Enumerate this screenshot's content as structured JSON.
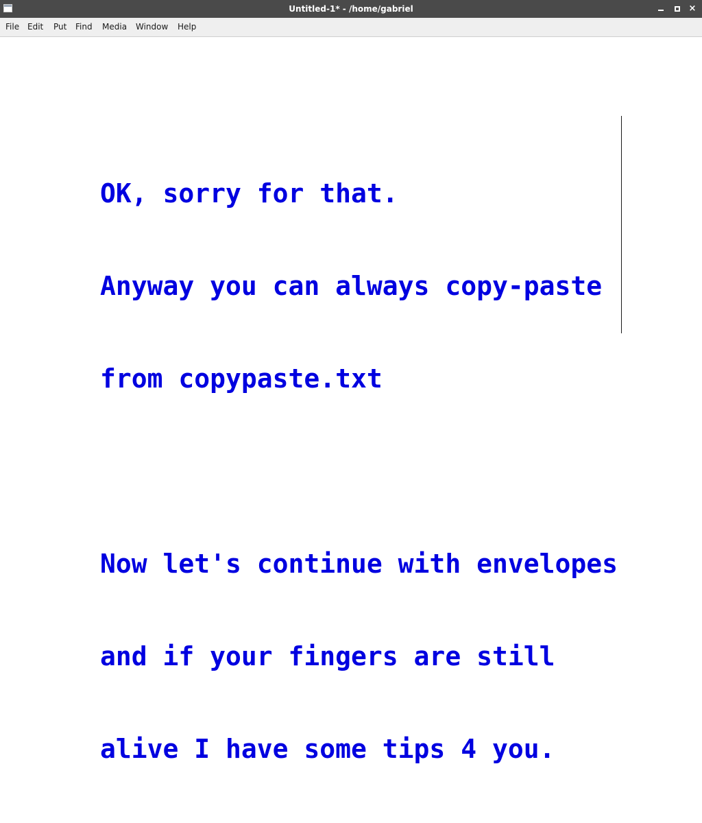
{
  "window": {
    "title": "Untitled-1* - /home/gabriel"
  },
  "window_controls": {
    "minimize_icon": "minimize-icon",
    "maximize_icon": "maximize-icon",
    "close_icon": "close-icon",
    "close_glyph": "×"
  },
  "menubar": {
    "items": [
      {
        "label": "File"
      },
      {
        "label": "Edit"
      },
      {
        "label": "Put"
      },
      {
        "label": "Find"
      },
      {
        "label": "Media"
      },
      {
        "label": "Window"
      },
      {
        "label": "Help"
      }
    ]
  },
  "document": {
    "text_color": "#0000e0",
    "lines": [
      "OK, sorry for that.",
      "Anyway you can always copy-paste",
      "from copypaste.txt",
      "",
      "Now let's continue with envelopes",
      "and if your fingers are still",
      "alive I have some tips 4 you."
    ]
  }
}
